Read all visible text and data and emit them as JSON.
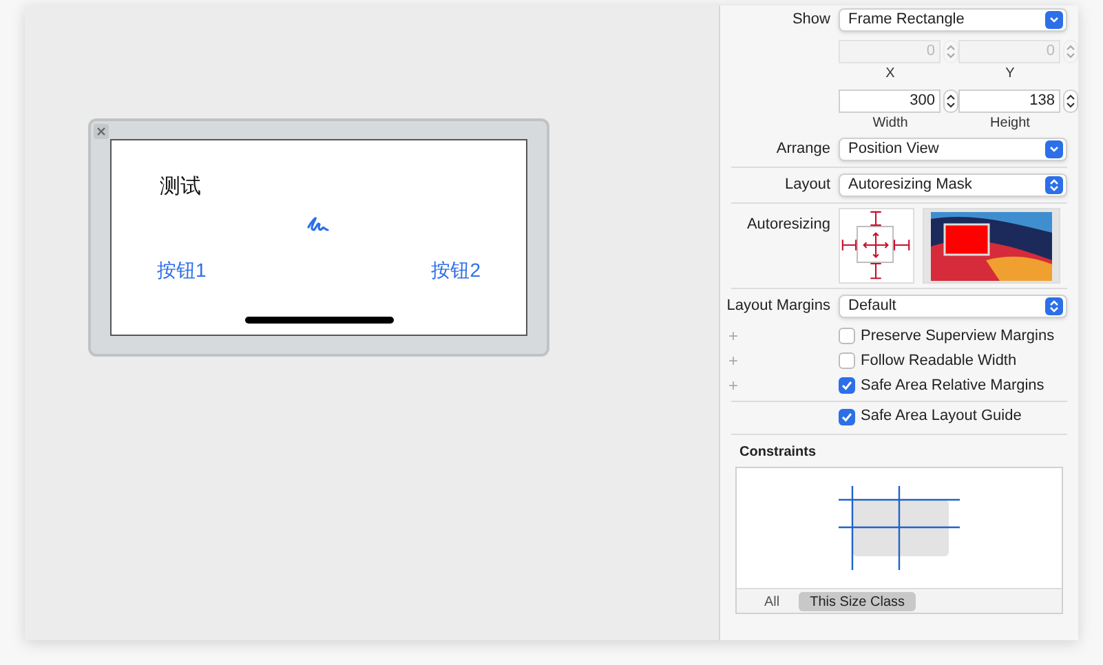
{
  "canvas": {
    "scene": {
      "title": "测试",
      "buttons": [
        "按钮1",
        "按钮2"
      ]
    }
  },
  "inspector": {
    "show": {
      "label": "Show",
      "value": "Frame Rectangle"
    },
    "position": [
      {
        "value": "0",
        "caption": "X",
        "disabled": true
      },
      {
        "value": "0",
        "caption": "Y",
        "disabled": true
      }
    ],
    "size": [
      {
        "value": "300",
        "caption": "Width",
        "disabled": false
      },
      {
        "value": "138",
        "caption": "Height",
        "disabled": false
      }
    ],
    "arrange": {
      "label": "Arrange",
      "value": "Position View"
    },
    "layout": {
      "label": "Layout",
      "value": "Autoresizing Mask"
    },
    "autoresizing": {
      "label": "Autoresizing"
    },
    "layout_margins": {
      "label": "Layout Margins",
      "value": "Default"
    },
    "options": [
      {
        "add": "+",
        "label": "Preserve Superview Margins",
        "checked": false
      },
      {
        "add": "+",
        "label": "Follow Readable Width",
        "checked": false
      },
      {
        "add": "+",
        "label": "Safe Area Relative Margins",
        "checked": true
      }
    ],
    "guide": {
      "label": "Safe Area Layout Guide",
      "checked": true
    },
    "constraints": {
      "title": "Constraints",
      "tabs": [
        {
          "label": "All",
          "selected": false
        },
        {
          "label": "This Size Class",
          "selected": true
        }
      ]
    }
  }
}
